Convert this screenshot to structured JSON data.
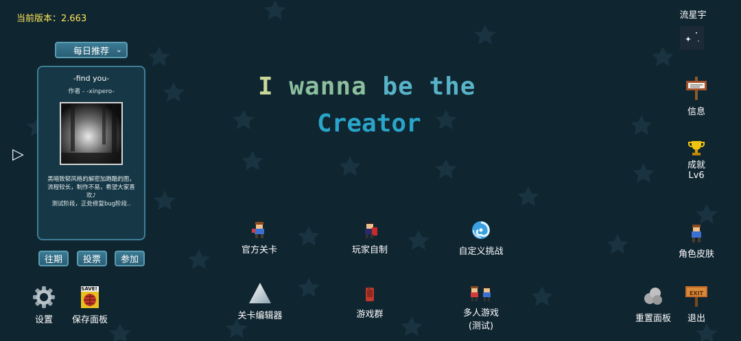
{
  "version_text": "当前版本：2.663",
  "dropdown": {
    "selected": "每日推荐"
  },
  "featured": {
    "title": "-find you-",
    "author": "作者 - -xinpero-",
    "description": "黑暗致郁风格的解密加跑酷的图，流程较长，制作不易，希望大家喜欢♪\n测试阶段，正处修复bug阶段.."
  },
  "panel_buttons": {
    "past": "往期",
    "vote": "投票",
    "join": "参加"
  },
  "game_title": {
    "line1_a": "I",
    "line1_b": "wanna",
    "line1_c": "be the",
    "line2": "Creator"
  },
  "menu": {
    "official_levels": "官方关卡",
    "player_made": "玩家自制",
    "custom_challenge": "自定义挑战",
    "level_editor": "关卡编辑器",
    "game_group": "游戏群",
    "multiplayer_1": "多人游戏",
    "multiplayer_2": "(测试)"
  },
  "bottom_left": {
    "settings": "设置",
    "save_panel": "保存面板",
    "save_sign": "SAVE!"
  },
  "right": {
    "meteor": "流星宇",
    "info": "信息",
    "achievement": "成就",
    "level": "Lv6",
    "skin": "角色皮肤",
    "reset_panel": "重置面板",
    "exit": "退出",
    "exit_sign": "EXIT"
  },
  "colors": {
    "background": "#0f2530",
    "version": "#ffe85a",
    "title_blue": "#2aa4c9",
    "button": "#2f6b82"
  }
}
